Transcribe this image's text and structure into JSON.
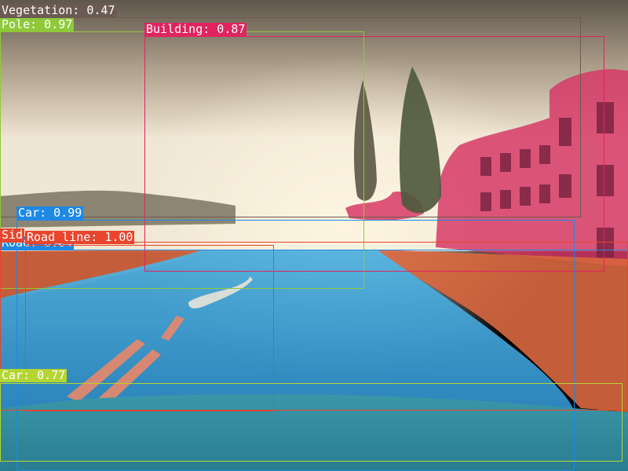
{
  "image": {
    "description_colors": {
      "sky_top": "#6e6557",
      "sky_mid": "#c9bba4",
      "horizon_glow": "#f4ecd9",
      "road": "#3fa3d6",
      "sidewalk": "#d9673f",
      "building": "#d63a66",
      "vegetation": "#5b5642",
      "hood": "#2f8fa3"
    }
  },
  "detections": [
    {
      "label": "Vegetation",
      "score": "0.47",
      "text": "Vegetation: 0.47",
      "color": "#6b5a52",
      "text_color": "#ffffff"
    },
    {
      "label": "Pole",
      "score": "0.97",
      "text": "Pole: 0.97",
      "color": "#8fc93a",
      "text_color": "#ffffff"
    },
    {
      "label": "Building",
      "score": "0.87",
      "text": "Building: 0.87",
      "color": "#e0245e",
      "text_color": "#ffffff"
    },
    {
      "label": "Car",
      "score": "0.99",
      "text": "Car: 0.99",
      "color": "#1e88e5",
      "text_color": "#ffffff"
    },
    {
      "label": "Sidewalk",
      "score": "",
      "text": "Sid",
      "color": "#e8452c",
      "text_color": "#ffffff"
    },
    {
      "label": "Road",
      "score": "0.84",
      "text": "Road: 0.84",
      "color": "#1e88e5",
      "text_color": "#ffffff"
    },
    {
      "label": "Road_line",
      "score": "1.00",
      "text": "Road_line: 1.00",
      "color": "#e8452c",
      "text_color": "#ffffff"
    },
    {
      "label": "Car",
      "score": "0.77",
      "text": "Car: 0.77",
      "color": "#b5d531",
      "text_color": "#ffffff"
    }
  ]
}
